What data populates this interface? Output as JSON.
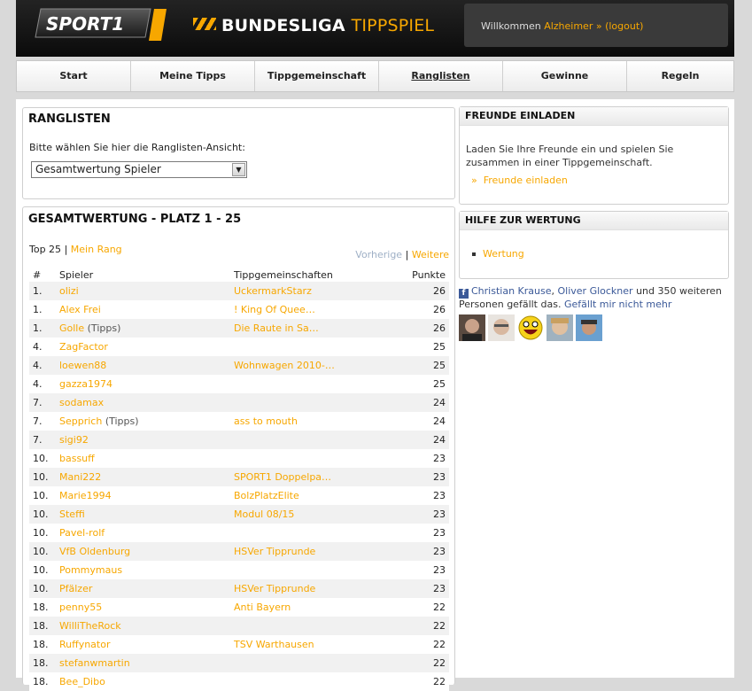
{
  "header": {
    "logo_text": "SPORT1",
    "title_main": "BUNDESLIGA",
    "title_accent": "TIPPSPIEL",
    "welcome": "Willkommen",
    "username": "Alzheimer »",
    "logout": "(logout)"
  },
  "nav": [
    {
      "label": "Start"
    },
    {
      "label": "Meine Tipps"
    },
    {
      "label": "Tippgemeinschaft"
    },
    {
      "label": "Ranglisten"
    },
    {
      "label": "Gewinne"
    },
    {
      "label": "Regeln"
    }
  ],
  "ranglisten": {
    "title": "RANGLISTEN",
    "select_label": "Bitte wählen Sie hier die Ranglisten-Ansicht:",
    "select_value": "Gesamtwertung Spieler"
  },
  "gesamt": {
    "title": "GESAMTWERTUNG - PLATZ 1 - 25",
    "top25": "Top 25",
    "sep": "|",
    "mein_rang": "Mein Rang",
    "prev": "Vorherige",
    "next": "Weitere",
    "columns": {
      "rank": "#",
      "player": "Spieler",
      "team": "Tippgemeinschaften",
      "points": "Punkte"
    },
    "rows": [
      {
        "rank": "1.",
        "player": "olizi",
        "extra": "",
        "team": "UckermarkStarz",
        "points": "26"
      },
      {
        "rank": "1.",
        "player": "Alex Frei",
        "extra": "",
        "team": "! King Of Quee…",
        "points": "26"
      },
      {
        "rank": "1.",
        "player": "Golle",
        "extra": "(Tipps)",
        "team": "Die Raute in Sa…",
        "points": "26"
      },
      {
        "rank": "4.",
        "player": "ZagFactor",
        "extra": "",
        "team": "",
        "points": "25"
      },
      {
        "rank": "4.",
        "player": "loewen88",
        "extra": "",
        "team": "Wohnwagen 2010-…",
        "points": "25"
      },
      {
        "rank": "4.",
        "player": "gazza1974",
        "extra": "",
        "team": "",
        "points": "25"
      },
      {
        "rank": "7.",
        "player": "sodamax",
        "extra": "",
        "team": "",
        "points": "24"
      },
      {
        "rank": "7.",
        "player": "Sepprich",
        "extra": "(Tipps)",
        "team": "ass to mouth",
        "points": "24"
      },
      {
        "rank": "7.",
        "player": "sigi92",
        "extra": "",
        "team": "",
        "points": "24"
      },
      {
        "rank": "10.",
        "player": "bassuff",
        "extra": "",
        "team": "",
        "points": "23"
      },
      {
        "rank": "10.",
        "player": "Mani222",
        "extra": "",
        "team": "SPORT1 Doppelpa…",
        "points": "23"
      },
      {
        "rank": "10.",
        "player": "Marie1994",
        "extra": "",
        "team": "BolzPlatzElite",
        "points": "23"
      },
      {
        "rank": "10.",
        "player": "Steffi",
        "extra": "",
        "team": "Modul 08/15",
        "points": "23"
      },
      {
        "rank": "10.",
        "player": "Pavel-rolf",
        "extra": "",
        "team": "",
        "points": "23"
      },
      {
        "rank": "10.",
        "player": "VfB Oldenburg",
        "extra": "",
        "team": "HSVer Tipprunde",
        "points": "23"
      },
      {
        "rank": "10.",
        "player": "Pommymaus",
        "extra": "",
        "team": "",
        "points": "23"
      },
      {
        "rank": "10.",
        "player": "Pfälzer",
        "extra": "",
        "team": "HSVer Tipprunde",
        "points": "23"
      },
      {
        "rank": "18.",
        "player": "penny55",
        "extra": "",
        "team": "Anti Bayern",
        "points": "22"
      },
      {
        "rank": "18.",
        "player": "WilliTheRock",
        "extra": "",
        "team": "",
        "points": "22"
      },
      {
        "rank": "18.",
        "player": "Ruffynator",
        "extra": "",
        "team": "TSV Warthausen",
        "points": "22"
      },
      {
        "rank": "18.",
        "player": "stefanwmartin",
        "extra": "",
        "team": "",
        "points": "22"
      },
      {
        "rank": "18.",
        "player": "Bee_Dibo",
        "extra": "",
        "team": "",
        "points": "22"
      }
    ]
  },
  "freunde": {
    "title": "FREUNDE EINLADEN",
    "text": "Laden Sie Ihre Freunde ein und spielen Sie zusammen in einer Tippgemeinschaft.",
    "link": "Freunde einladen",
    "link_prefix": "»"
  },
  "hilfe": {
    "title": "HILFE ZUR WERTUNG",
    "link": "Wertung"
  },
  "facebook": {
    "friend1": "Christian Krause",
    "comma": ",",
    "friend2": "Oliver Glockner",
    "rest": "und 350 weiteren Personen gefällt das.",
    "unlike": "Gefällt mir nicht mehr"
  },
  "colors": {
    "accent": "#f7a700",
    "header_bg": "#111111",
    "fb_blue": "#3b5998"
  }
}
